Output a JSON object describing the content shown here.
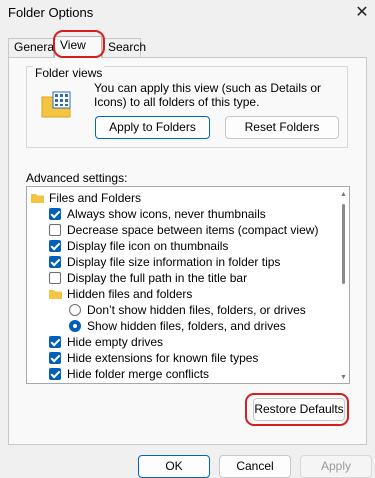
{
  "window": {
    "title": "Folder Options",
    "close_glyph": "✕"
  },
  "tabs": [
    {
      "label": "General"
    },
    {
      "label": "View"
    },
    {
      "label": "Search"
    }
  ],
  "folder_views": {
    "legend": "Folder views",
    "description": "You can apply this view (such as Details or Icons) to all folders of this type.",
    "apply_label": "Apply to Folders",
    "reset_label": "Reset Folders"
  },
  "advanced": {
    "label": "Advanced settings:",
    "items": [
      {
        "kind": "folder",
        "label": "Files and Folders"
      },
      {
        "kind": "checkbox",
        "checked": true,
        "label": "Always show icons, never thumbnails"
      },
      {
        "kind": "checkbox",
        "checked": false,
        "label": "Decrease space between items (compact view)"
      },
      {
        "kind": "checkbox",
        "checked": true,
        "label": "Display file icon on thumbnails"
      },
      {
        "kind": "checkbox",
        "checked": true,
        "label": "Display file size information in folder tips"
      },
      {
        "kind": "checkbox",
        "checked": false,
        "label": "Display the full path in the title bar"
      },
      {
        "kind": "folder",
        "label": "Hidden files and folders"
      },
      {
        "kind": "radio",
        "checked": false,
        "label": "Don’t show hidden files, folders, or drives"
      },
      {
        "kind": "radio",
        "checked": true,
        "label": "Show hidden files, folders, and drives"
      },
      {
        "kind": "checkbox",
        "checked": true,
        "label": "Hide empty drives"
      },
      {
        "kind": "checkbox",
        "checked": true,
        "label": "Hide extensions for known file types"
      },
      {
        "kind": "checkbox",
        "checked": true,
        "label": "Hide folder merge conflicts"
      }
    ]
  },
  "buttons": {
    "restore": "Restore Defaults",
    "ok": "OK",
    "cancel": "Cancel",
    "apply": "Apply"
  },
  "colors": {
    "accent": "#005fb8",
    "highlight": "#d42020",
    "folder": "#f4c542"
  }
}
